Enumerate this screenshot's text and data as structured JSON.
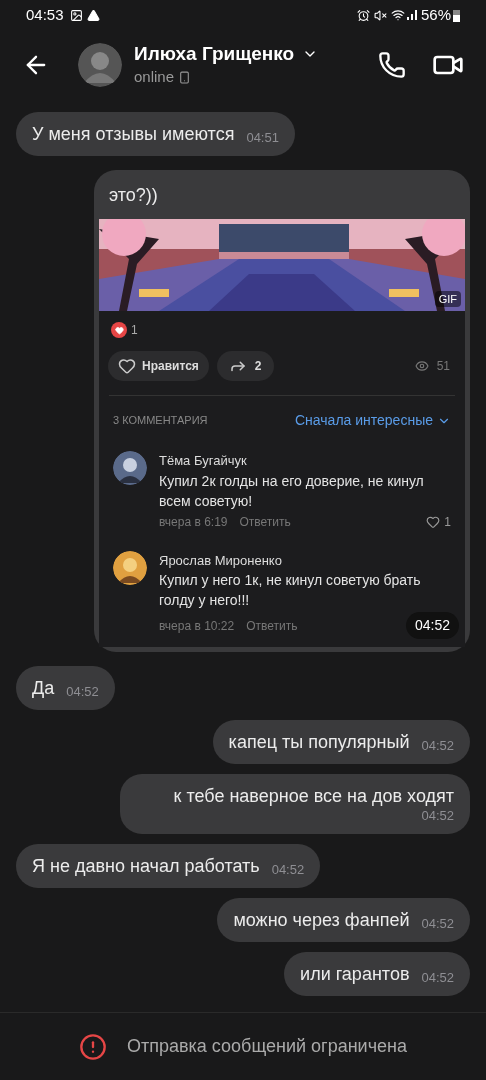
{
  "status_bar": {
    "time": "04:53",
    "battery": "56%"
  },
  "header": {
    "name": "Илюха Грищенко",
    "status": "online"
  },
  "messages": [
    {
      "kind": "text",
      "outgoing": false,
      "text": "У меня отзывы имеются",
      "time": "04:51"
    },
    {
      "kind": "post",
      "text": "это?))",
      "badge": "GIF",
      "reaction_count": "1",
      "like_label": "Нравится",
      "share_count": "2",
      "views": "51",
      "comments_title": "3 КОММЕНТАРИЯ",
      "sort_label": "Сначала интересные",
      "time": "04:52",
      "comments": [
        {
          "author": "Тёма Бугайчук",
          "text": "Купил 2к голды на его доверие, не кинул всем советую!",
          "date": "вчера в 6:19",
          "reply": "Ответить",
          "likes": "1"
        },
        {
          "author": "Ярослав Мироненко",
          "text": "Купил у него 1к, не кинул  советую брать голду у него!!!",
          "date": "вчера в 10:22",
          "reply": "Ответить"
        }
      ]
    },
    {
      "kind": "text",
      "outgoing": false,
      "text": "Да",
      "time": "04:52"
    },
    {
      "kind": "text",
      "outgoing": true,
      "text": "капец ты популярный",
      "time": "04:52"
    },
    {
      "kind": "text",
      "outgoing": true,
      "text": "к тебе наверное все на дов ходят",
      "time": "04:52",
      "wrap_time": true
    },
    {
      "kind": "text",
      "outgoing": false,
      "text": "Я не давно начал работать",
      "time": "04:52"
    },
    {
      "kind": "text",
      "outgoing": true,
      "text": "можно через фанпей",
      "time": "04:52"
    },
    {
      "kind": "text",
      "outgoing": true,
      "text": "или гарантов",
      "time": "04:52"
    }
  ],
  "footer": {
    "text": "Отправка сообщений ограничена"
  }
}
